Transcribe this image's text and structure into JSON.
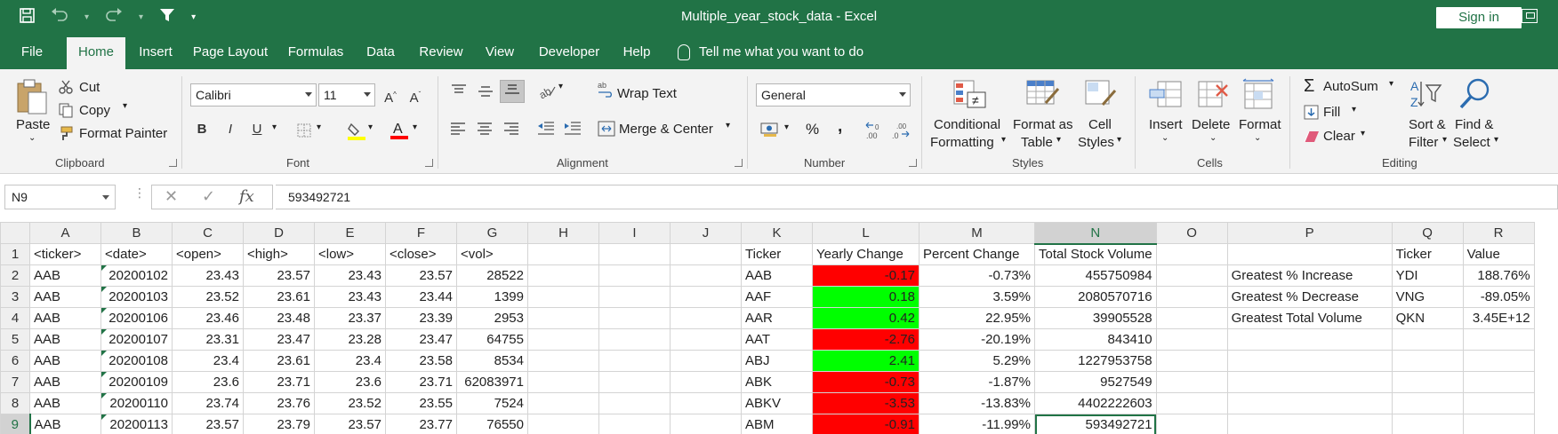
{
  "app": {
    "title": "Multiple_year_stock_data  -  Excel",
    "sign_in": "Sign in"
  },
  "tabs": [
    "File",
    "Home",
    "Insert",
    "Page Layout",
    "Formulas",
    "Data",
    "Review",
    "View",
    "Developer",
    "Help"
  ],
  "tell_me": "Tell me what you want to do",
  "ribbon": {
    "clipboard": {
      "label": "Clipboard",
      "paste": "Paste",
      "cut": "Cut",
      "copy": "Copy",
      "format_painter": "Format Painter"
    },
    "font": {
      "label": "Font",
      "name": "Calibri",
      "size": "11",
      "bold": "B",
      "italic": "I",
      "underline": "U"
    },
    "alignment": {
      "label": "Alignment",
      "wrap_text": "Wrap Text",
      "merge_center": "Merge & Center"
    },
    "number": {
      "label": "Number",
      "format": "General",
      "percent": "%",
      "comma": ","
    },
    "styles": {
      "label": "Styles",
      "conditional_1": "Conditional",
      "conditional_2": "Formatting",
      "format_table_1": "Format as",
      "format_table_2": "Table",
      "cell_styles_1": "Cell",
      "cell_styles_2": "Styles"
    },
    "cells": {
      "label": "Cells",
      "insert": "Insert",
      "delete": "Delete",
      "format": "Format"
    },
    "editing": {
      "label": "Editing",
      "autosum": "AutoSum",
      "fill": "Fill",
      "clear": "Clear",
      "sort_1": "Sort &",
      "sort_2": "Filter",
      "find_1": "Find &",
      "find_2": "Select"
    }
  },
  "formula_bar": {
    "name_box": "N9",
    "fx": "fx",
    "content": "593492721"
  },
  "sheet": {
    "columns": [
      "A",
      "B",
      "C",
      "D",
      "E",
      "F",
      "G",
      "H",
      "I",
      "J",
      "K",
      "L",
      "M",
      "N",
      "O",
      "P",
      "Q",
      "R"
    ],
    "rows": [
      [
        "<ticker>",
        "<date>",
        "<open>",
        "<high>",
        "<low>",
        "<close>",
        "<vol>",
        "",
        "",
        "",
        "Ticker",
        "Yearly Change",
        "Percent Change",
        "Total Stock Volume",
        "",
        "",
        "Ticker",
        "Value"
      ],
      [
        "AAB",
        "20200102",
        "23.43",
        "23.57",
        "23.43",
        "23.57",
        "28522",
        "",
        "",
        "",
        "AAB",
        "-0.17",
        "-0.73%",
        "455750984",
        "",
        "Greatest % Increase",
        "YDI",
        "188.76%"
      ],
      [
        "AAB",
        "20200103",
        "23.52",
        "23.61",
        "23.43",
        "23.44",
        "1399",
        "",
        "",
        "",
        "AAF",
        "0.18",
        "3.59%",
        "2080570716",
        "",
        "Greatest % Decrease",
        "VNG",
        "-89.05%"
      ],
      [
        "AAB",
        "20200106",
        "23.46",
        "23.48",
        "23.37",
        "23.39",
        "2953",
        "",
        "",
        "",
        "AAR",
        "0.42",
        "22.95%",
        "39905528",
        "",
        "Greatest Total Volume",
        "QKN",
        "3.45E+12"
      ],
      [
        "AAB",
        "20200107",
        "23.31",
        "23.47",
        "23.28",
        "23.47",
        "64755",
        "",
        "",
        "",
        "AAT",
        "-2.76",
        "-20.19%",
        "843410",
        "",
        "",
        "",
        ""
      ],
      [
        "AAB",
        "20200108",
        "23.4",
        "23.61",
        "23.4",
        "23.58",
        "8534",
        "",
        "",
        "",
        "ABJ",
        "2.41",
        "5.29%",
        "1227953758",
        "",
        "",
        "",
        ""
      ],
      [
        "AAB",
        "20200109",
        "23.6",
        "23.71",
        "23.6",
        "23.71",
        "62083971",
        "",
        "",
        "",
        "ABK",
        "-0.73",
        "-1.87%",
        "9527549",
        "",
        "",
        "",
        ""
      ],
      [
        "AAB",
        "20200110",
        "23.74",
        "23.76",
        "23.52",
        "23.55",
        "7524",
        "",
        "",
        "",
        "ABKV",
        "-3.53",
        "-13.83%",
        "4402222603",
        "",
        "",
        "",
        ""
      ],
      [
        "AAB",
        "20200113",
        "23.57",
        "23.79",
        "23.57",
        "23.77",
        "76550",
        "",
        "",
        "",
        "ABM",
        "-0.91",
        "-11.99%",
        "593492721",
        "",
        "",
        "",
        ""
      ]
    ],
    "yearly_change_colors": [
      "red",
      "green",
      "green",
      "red",
      "green",
      "red",
      "red",
      "red"
    ],
    "active_cell": "N9"
  },
  "colors": {
    "excel_green": "#217346",
    "negative": "#ff0000",
    "positive": "#00ff00"
  }
}
